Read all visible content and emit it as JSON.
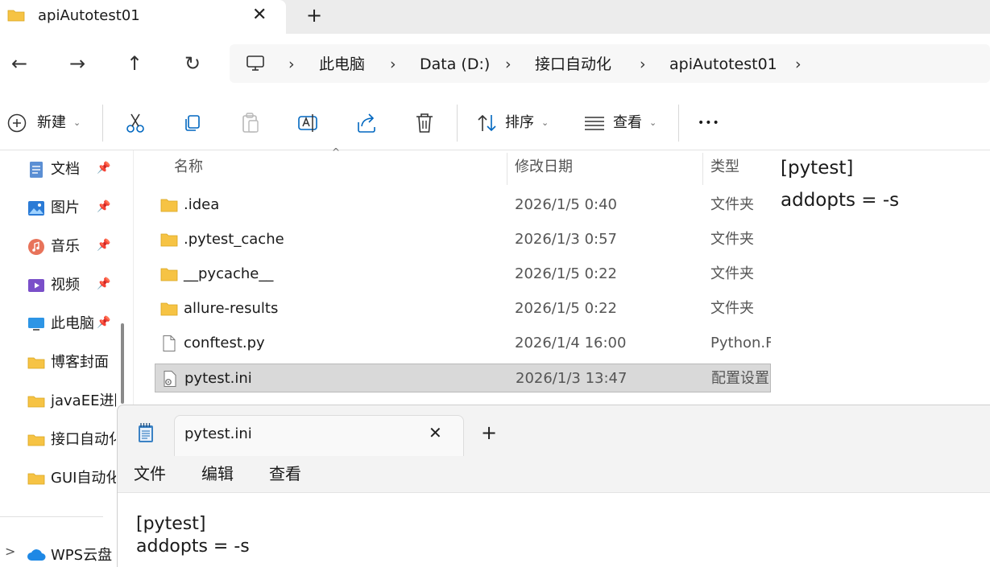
{
  "window": {
    "tab_title": "apiAutotest01",
    "close_glyph": "✕",
    "new_tab_glyph": "+"
  },
  "nav": {
    "back_glyph": "←",
    "forward_glyph": "→",
    "up_glyph": "↑",
    "refresh_glyph": "↻",
    "breadcrumbs": [
      "此电脑",
      "Data (D:)",
      "接口自动化",
      "apiAutotest01"
    ],
    "chevron": "›"
  },
  "toolbar": {
    "new_label": "新建",
    "sort_label": "排序",
    "view_label": "查看",
    "more_glyph": "•••",
    "caret": "⌄"
  },
  "sidebar": {
    "items": [
      {
        "label": "文档",
        "icon": "document-icon",
        "pinned": true
      },
      {
        "label": "图片",
        "icon": "pictures-icon",
        "pinned": true
      },
      {
        "label": "音乐",
        "icon": "music-icon",
        "pinned": true
      },
      {
        "label": "视频",
        "icon": "video-icon",
        "pinned": true
      },
      {
        "label": "此电脑",
        "icon": "computer-icon",
        "pinned": true
      },
      {
        "label": "博客封面",
        "icon": "folder-icon",
        "pinned": false
      },
      {
        "label": "javaEE进阶",
        "icon": "folder-icon",
        "pinned": false
      },
      {
        "label": "接口自动化",
        "icon": "folder-icon",
        "pinned": false
      },
      {
        "label": "GUI自动化",
        "icon": "folder-icon",
        "pinned": false
      }
    ],
    "pin_glyph": "📌",
    "cloud": {
      "label": "WPS云盘",
      "expand_glyph": ">"
    }
  },
  "columns": {
    "name": "名称",
    "modified": "修改日期",
    "type": "类型"
  },
  "files": [
    {
      "name": ".idea",
      "date": "2026/1/5 0:40",
      "type": "文件夹",
      "kind": "folder"
    },
    {
      "name": ".pytest_cache",
      "date": "2026/1/3 0:57",
      "type": "文件夹",
      "kind": "folder"
    },
    {
      "name": "__pycache__",
      "date": "2026/1/5 0:22",
      "type": "文件夹",
      "kind": "folder"
    },
    {
      "name": "allure-results",
      "date": "2026/1/5 0:22",
      "type": "文件夹",
      "kind": "folder"
    },
    {
      "name": "conftest.py",
      "date": "2026/1/4 16:00",
      "type": "Python.F",
      "kind": "file"
    },
    {
      "name": "pytest.ini",
      "date": "2026/1/3 13:47",
      "type": "配置设置",
      "kind": "ini",
      "selected": true
    }
  ],
  "preview": {
    "lines": [
      "[pytest]",
      "addopts = -s"
    ]
  },
  "notepad": {
    "tab_title": "pytest.ini",
    "close_glyph": "✕",
    "new_tab_glyph": "+",
    "menu": [
      "文件",
      "编辑",
      "查看"
    ],
    "lines": [
      "[pytest]",
      "addopts = -s"
    ]
  },
  "colors": {
    "folder": "#f6c344",
    "accent": "#0067c0",
    "selected_row": "#d9d9d9"
  }
}
